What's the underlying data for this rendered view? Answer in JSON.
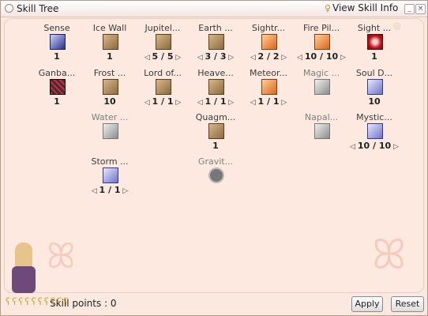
{
  "window": {
    "title": "Skill Tree",
    "view_skill_info": "View Skill Info",
    "minimize": "_",
    "close": "×"
  },
  "skills": [
    {
      "name": "Sense",
      "level": "1",
      "icon": "target-icon",
      "style": "blue",
      "dim": false,
      "arrows": false
    },
    {
      "name": "Ice Wall",
      "level": "1",
      "icon": "ice-wall-icon",
      "style": "book",
      "dim": false,
      "arrows": false
    },
    {
      "name": "Jupitel...",
      "level": "5 / 5",
      "icon": "jupitel-thunder-icon",
      "style": "book",
      "dim": false,
      "arrows": true
    },
    {
      "name": "Earth ...",
      "level": "3 / 3",
      "icon": "earth-spike-icon",
      "style": "book",
      "dim": false,
      "arrows": true
    },
    {
      "name": "Sightr...",
      "level": "2 / 2",
      "icon": "sightrasher-icon",
      "style": "orange",
      "dim": false,
      "arrows": true
    },
    {
      "name": "Fire Pil...",
      "level": "10 / 10",
      "icon": "fire-pillar-icon",
      "style": "orange",
      "dim": false,
      "arrows": true
    },
    {
      "name": "Sight ...",
      "level": "1",
      "icon": "sight-blaster-icon",
      "style": "red",
      "dim": false,
      "arrows": false
    },
    {
      "name": "Ganba...",
      "level": "1",
      "icon": "ganbantein-icon",
      "style": "grid",
      "dim": false,
      "arrows": false
    },
    {
      "name": "Frost ...",
      "level": "10",
      "icon": "frost-nova-icon",
      "style": "book",
      "dim": false,
      "arrows": false
    },
    {
      "name": "Lord of...",
      "level": "1 / 1",
      "icon": "lord-of-vermilion-icon",
      "style": "book",
      "dim": false,
      "arrows": true
    },
    {
      "name": "Heave...",
      "level": "1 / 1",
      "icon": "heavens-drive-icon",
      "style": "book",
      "dim": false,
      "arrows": true
    },
    {
      "name": "Meteor...",
      "level": "1 / 1",
      "icon": "meteor-storm-icon",
      "style": "orange",
      "dim": false,
      "arrows": true
    },
    {
      "name": "Magic ...",
      "level": "",
      "icon": "magic-crasher-icon",
      "style": "gray",
      "dim": true,
      "arrows": false
    },
    {
      "name": "Soul D...",
      "level": "10",
      "icon": "soul-drain-icon",
      "style": "silver",
      "dim": false,
      "arrows": false
    },
    {
      "name": "Water ...",
      "level": "",
      "icon": "water-ball-icon",
      "style": "gray",
      "dim": true,
      "arrows": false
    },
    {
      "name": "Quagm...",
      "level": "1",
      "icon": "quagmire-icon",
      "style": "book",
      "dim": false,
      "arrows": false
    },
    {
      "name": "Napal...",
      "level": "",
      "icon": "napalm-vulcan-icon",
      "style": "gray",
      "dim": true,
      "arrows": false
    },
    {
      "name": "Mystic...",
      "level": "10 / 10",
      "icon": "mystical-amplification-icon",
      "style": "silver",
      "dim": false,
      "arrows": true
    },
    {
      "name": "Storm ...",
      "level": "1 / 1",
      "icon": "storm-gust-icon",
      "style": "silver",
      "dim": false,
      "arrows": true
    },
    {
      "name": "Gravit...",
      "level": "",
      "icon": "gravitation-field-icon",
      "style": "gravstamp",
      "dim": true,
      "arrows": false
    }
  ],
  "footer": {
    "skill_points": "Skill points : 0",
    "apply": "Apply",
    "reset": "Reset"
  }
}
